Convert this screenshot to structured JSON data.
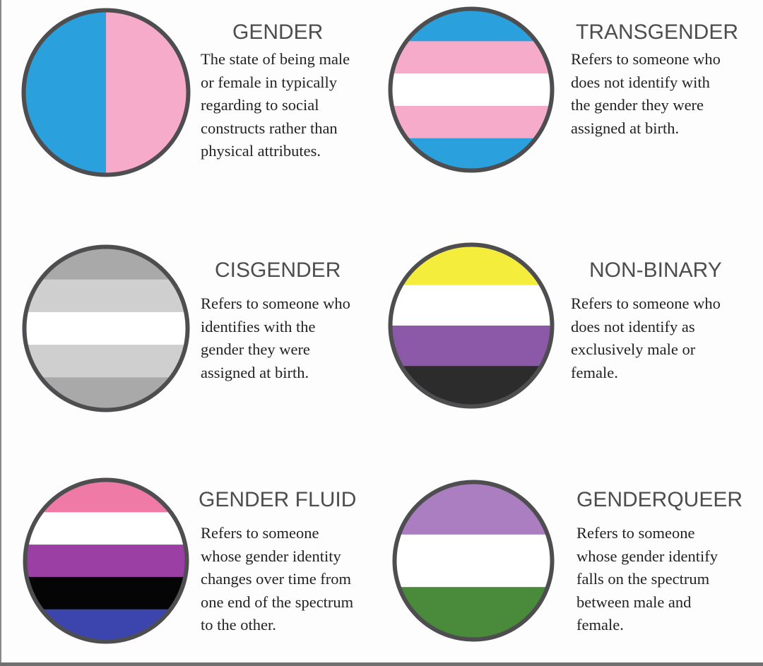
{
  "items": [
    {
      "title": "GENDER",
      "description": "The state of being male\nor female in typically\nregarding to social\nconstructs rather than\nphysical attributes.",
      "icon": "gender-flag-icon",
      "colors": [
        "#2aa1dc",
        "#f5abc9"
      ]
    },
    {
      "title": "TRANSGENDER",
      "description": "Refers to someone who\ndoes not identify with\nthe gender they were\nassigned at birth.",
      "icon": "transgender-flag-icon",
      "colors": [
        "#2aa1dc",
        "#f5abc9",
        "#ffffff",
        "#f5abc9",
        "#2aa1dc"
      ]
    },
    {
      "title": "CISGENDER",
      "description": "Refers to someone who\nidentifies with the\ngender they were\nassigned at birth.",
      "icon": "cisgender-flag-icon",
      "colors": [
        "#a9a9a9",
        "#cfcfcf",
        "#ffffff",
        "#cfcfcf",
        "#a9a9a9"
      ]
    },
    {
      "title": "NON-BINARY",
      "description": "Refers to someone who\ndoes not identify as\nexclusively male or\nfemale.",
      "icon": "non-binary-flag-icon",
      "colors": [
        "#f5ed3c",
        "#ffffff",
        "#8b59a8",
        "#2c2c2c"
      ]
    },
    {
      "title": "GENDER FLUID",
      "description": "Refers to someone\nwhose gender identity\nchanges over time from\none end of the spectrum\nto the other.",
      "icon": "gender-fluid-flag-icon",
      "colors": [
        "#f07aa6",
        "#ffffff",
        "#9b3fa5",
        "#050505",
        "#3b45ad"
      ]
    },
    {
      "title": "GENDERQUEER",
      "description": "Refers to someone\nwhose gender identify\nfalls on the spectrum\nbetween male and\nfemale.",
      "icon": "genderqueer-flag-icon",
      "colors": [
        "#ab7ec2",
        "#ffffff",
        "#4a8a3b"
      ]
    }
  ],
  "ring_color": "#4e4e50"
}
